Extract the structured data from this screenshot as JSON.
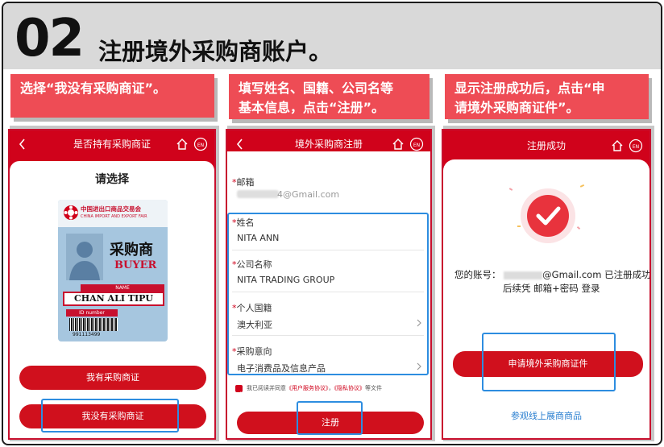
{
  "header": {
    "step_number": "02",
    "title": "注册境外采购商账户。"
  },
  "captions": [
    {
      "lines": [
        "选择“我没有采购商证”。"
      ]
    },
    {
      "lines": [
        "填写姓名、国籍、公司名等",
        "基本信息，点击“注册”。"
      ]
    },
    {
      "lines": [
        "显示注册成功后，点击“申",
        "请境外采购商证件”。"
      ]
    }
  ],
  "phone1": {
    "title": "是否持有采购商证",
    "prompt": "请选择",
    "badge": {
      "fair_name_cn": "中国进出口商品交易会",
      "fair_name_en": "CHINA IMPORT AND EXPORT FAIR",
      "role_cn": "采购商",
      "role_en": "BUYER",
      "name_label": "NAME",
      "holder_name": "CHAN ALI TIPU",
      "id_label": "ID number",
      "id_value": "991113499"
    },
    "buttons": {
      "have": "我有采购商证",
      "have_not": "我没有采购商证"
    }
  },
  "phone2": {
    "title": "境外采购商注册",
    "email": {
      "label": "邮箱",
      "value": "4@Gmail.com"
    },
    "name": {
      "label": "姓名",
      "value": "NITA ANN"
    },
    "company": {
      "label": "公司名称",
      "value": "NITA TRADING GROUP"
    },
    "nationality": {
      "label": "个人国籍",
      "value": "澳大利亚"
    },
    "intent": {
      "label": "采购意向",
      "value": "电子消费品及信息产品"
    },
    "agreement": {
      "prefix": "我已阅读并同意",
      "service": "《用户服务协议》",
      "sep": "，",
      "privacy": "《隐私协议》",
      "suffix": "等文件"
    },
    "submit": "注册"
  },
  "phone3": {
    "title": "注册成功",
    "account_prefix": "您的账号：",
    "account_email": "@Gmail.com",
    "account_suffix": "已注册成功",
    "login_hint": "后续凭 邮箱+密码 登录",
    "apply_button": "申请境外采购商证件",
    "browse_link": "参观线上展商商品"
  },
  "colors": {
    "brand_red": "#d0021b",
    "caption_red": "#ee4c55",
    "highlight_blue": "#2d8de0"
  }
}
